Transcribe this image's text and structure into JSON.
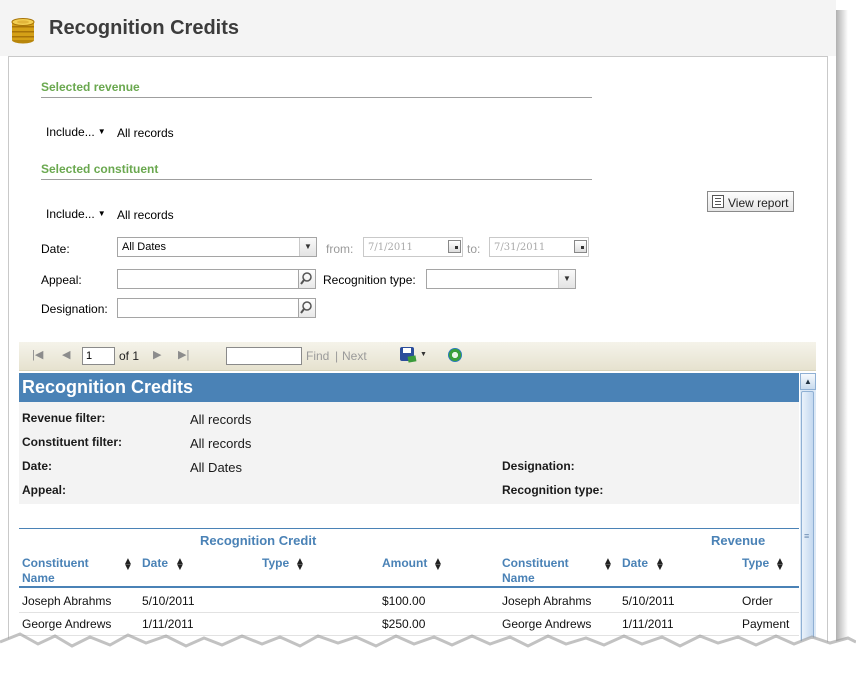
{
  "page": {
    "title": "Recognition Credits"
  },
  "criteria": {
    "selected_revenue": {
      "heading": "Selected revenue",
      "include_label": "Include...",
      "value": "All records"
    },
    "selected_constituent": {
      "heading": "Selected constituent",
      "include_label": "Include...",
      "value": "All records"
    },
    "date": {
      "label": "Date:",
      "value": "All Dates",
      "from_label": "from:",
      "from_value": "7/1/2011",
      "to_label": "to:",
      "to_value": "7/31/2011"
    },
    "appeal": {
      "label": "Appeal:"
    },
    "recognition_type": {
      "label": "Recognition type:"
    },
    "designation": {
      "label": "Designation:"
    },
    "view_report_label": "View report"
  },
  "toolbar": {
    "page_value": "1",
    "of_label": "of 1",
    "find_label": "Find",
    "separator": "|",
    "next_label": "Next"
  },
  "report": {
    "title": "Recognition Credits",
    "filters": {
      "revenue_filter_label": "Revenue filter:",
      "revenue_filter_value": "All records",
      "constituent_filter_label": "Constituent filter:",
      "constituent_filter_value": "All records",
      "date_label": "Date:",
      "date_value": "All Dates",
      "appeal_label": "Appeal:",
      "designation_label": "Designation:",
      "recognition_type_label": "Recognition type:"
    },
    "group_headers": {
      "recognition_credit": "Recognition Credit",
      "revenue": "Revenue"
    },
    "columns": {
      "rc_constituent": "Constituent Name",
      "rc_date": "Date",
      "rc_type": "Type",
      "rc_amount": "Amount",
      "rev_constituent": "Constituent Name",
      "rev_date": "Date",
      "rev_type": "Type"
    },
    "rows": [
      {
        "rc_constituent": "Joseph Abrahms",
        "rc_date": "5/10/2011",
        "rc_type": "",
        "rc_amount": "$100.00",
        "rev_constituent": "Joseph Abrahms",
        "rev_date": "5/10/2011",
        "rev_type": "Order"
      },
      {
        "rc_constituent": "George Andrews",
        "rc_date": "1/11/2011",
        "rc_type": "",
        "rc_amount": "$250.00",
        "rev_constituent": "George Andrews",
        "rev_date": "1/11/2011",
        "rev_type": "Payment"
      }
    ]
  },
  "icons": {
    "title": "coins-icon",
    "search": "magnifier-icon",
    "calendar": "calendar-icon",
    "view_report": "report-icon",
    "first": "first-page-icon",
    "prev": "previous-page-icon",
    "next": "next-page-icon",
    "last": "last-page-icon",
    "export": "save-export-icon",
    "refresh": "refresh-icon"
  },
  "colors": {
    "accent_green": "#6aa84f",
    "report_blue": "#4a82b6",
    "toolbar_bg": "#ece9d8"
  }
}
